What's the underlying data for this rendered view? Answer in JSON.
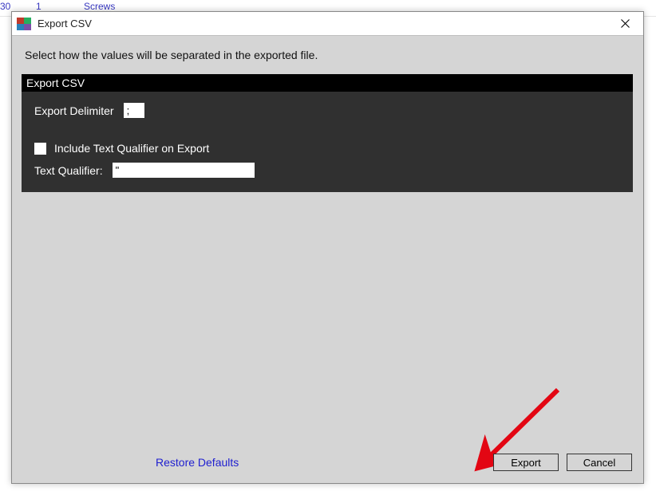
{
  "background": {
    "row_truncated_num": "30",
    "col1": "1",
    "col2": "Screws"
  },
  "dialog": {
    "title": "Export CSV",
    "instruction": "Select how the values will be separated in the exported file.",
    "panel_title": "Export CSV",
    "delimiter_label": "Export Delimiter",
    "delimiter_value": ";",
    "include_qualifier_label": "Include Text Qualifier on Export",
    "include_qualifier_checked": false,
    "text_qualifier_label": "Text Qualifier:",
    "text_qualifier_value": "\"",
    "restore_defaults": "Restore Defaults",
    "export_button": "Export",
    "cancel_button": "Cancel"
  }
}
